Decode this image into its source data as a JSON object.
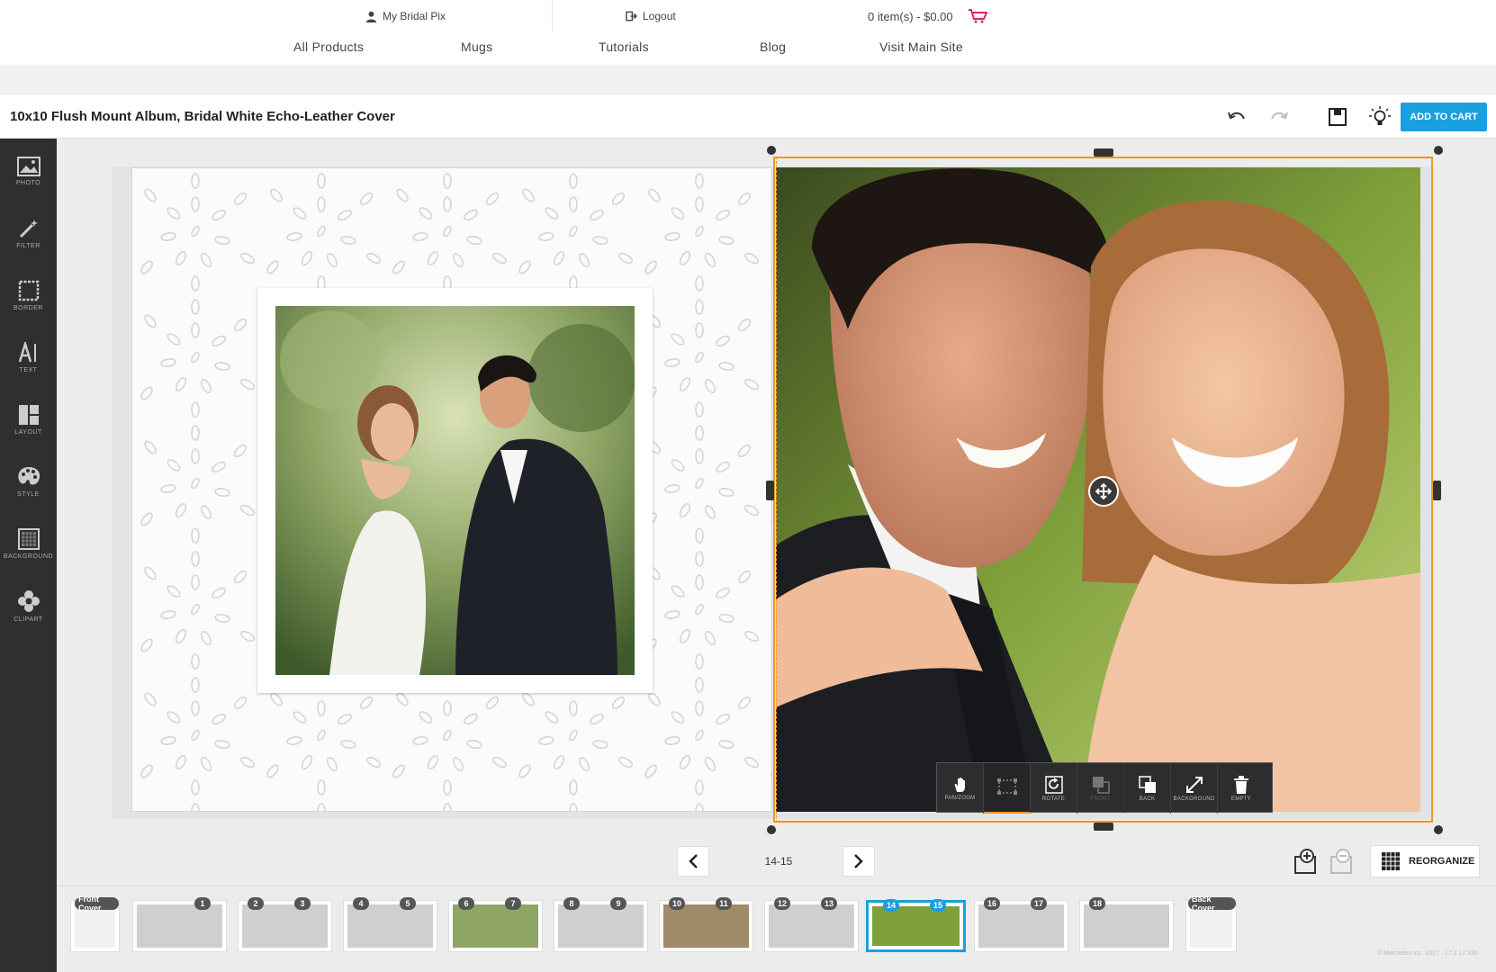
{
  "header": {
    "account_label": "My Bridal Pix",
    "logout_label": "Logout",
    "cart_label": "0 item(s) - $0.00",
    "nav": [
      "All Products",
      "Mugs",
      "Tutorials",
      "Blog",
      "Visit Main Site"
    ]
  },
  "titlebar": {
    "title": "10x10 Flush Mount Album, Bridal White Echo-Leather Cover",
    "add_to_cart": "ADD TO CART"
  },
  "tools": [
    {
      "label": "PHOTO",
      "icon": "photo-icon"
    },
    {
      "label": "FILTER",
      "icon": "magic-wand-icon"
    },
    {
      "label": "BORDER",
      "icon": "border-icon"
    },
    {
      "label": "TEXT",
      "icon": "text-icon"
    },
    {
      "label": "LAYOUT",
      "icon": "layout-icon"
    },
    {
      "label": "STYLE",
      "icon": "palette-icon"
    },
    {
      "label": "BACKGROUND",
      "icon": "background-icon"
    },
    {
      "label": "CLIPART",
      "icon": "flower-icon"
    }
  ],
  "photo_toolbar": [
    {
      "label": "PAN/ZOOM",
      "icon": "hand-icon"
    },
    {
      "label": "",
      "icon": "crop-icon"
    },
    {
      "label": "ROTATE",
      "icon": "rotate-icon"
    },
    {
      "label": "FRONT",
      "icon": "bring-front-icon"
    },
    {
      "label": "BACK",
      "icon": "send-back-icon"
    },
    {
      "label": "BACKGROUND",
      "icon": "expand-icon"
    },
    {
      "label": "EMPTY",
      "icon": "trash-icon"
    }
  ],
  "pager": {
    "label": "14-15"
  },
  "reorganize_label": "REORGANIZE",
  "thumbnails": {
    "front": "Front Cover",
    "back": "Back Cover",
    "pages": [
      "1",
      "2",
      "3",
      "4",
      "5",
      "6",
      "7",
      "8",
      "9",
      "10",
      "11",
      "12",
      "13",
      "14",
      "15",
      "16",
      "17",
      "18"
    ]
  },
  "copyright": "© Mercedes Inc. 2017 · 17.2.17.330",
  "colors": {
    "accent": "#1a9fe0",
    "selection": "#f39621",
    "toolbar": "#2f2f31"
  }
}
